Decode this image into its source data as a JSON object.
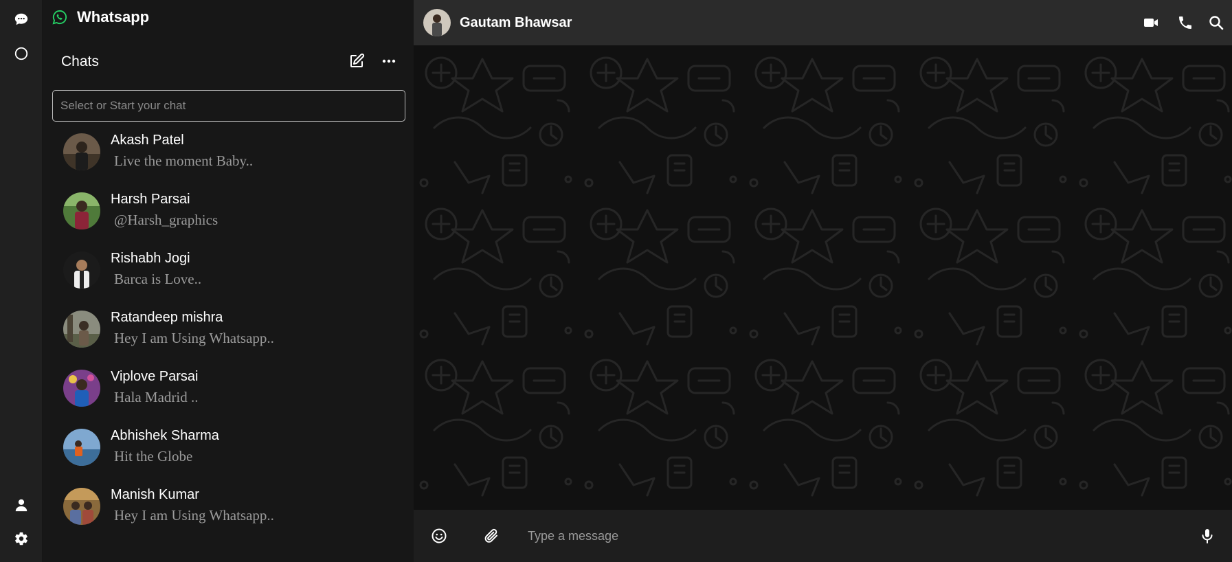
{
  "app": {
    "title": "Whatsapp",
    "brand_color": "#25d366"
  },
  "rail": {
    "top_icons": [
      "chat-bubble-icon",
      "status-icon"
    ],
    "bottom_icons": [
      "profile-icon",
      "settings-icon"
    ]
  },
  "sidebar": {
    "heading": "Chats",
    "actions": [
      "new-chat-icon",
      "more-options-icon"
    ],
    "search_placeholder": "Select or Start your chat",
    "chats": [
      {
        "name": "Akash Patel",
        "message": "Live the moment Baby.."
      },
      {
        "name": "Harsh Parsai",
        "message": "@Harsh_graphics"
      },
      {
        "name": "Rishabh Jogi",
        "message": "Barca is Love.."
      },
      {
        "name": "Ratandeep mishra",
        "message": "Hey I am Using Whatsapp.."
      },
      {
        "name": "Viplove Parsai",
        "message": "Hala Madrid .."
      },
      {
        "name": "Abhishek Sharma",
        "message": "Hit the Globe"
      },
      {
        "name": "Manish Kumar",
        "message": "Hey I am Using Whatsapp.."
      }
    ]
  },
  "conversation": {
    "contact_name": "Gautam Bhawsar",
    "header_icons": [
      "video-call-icon",
      "voice-call-icon",
      "search-icon"
    ],
    "composer": {
      "placeholder": "Type a message",
      "icons": [
        "emoji-icon",
        "attach-icon",
        "microphone-icon"
      ]
    }
  }
}
